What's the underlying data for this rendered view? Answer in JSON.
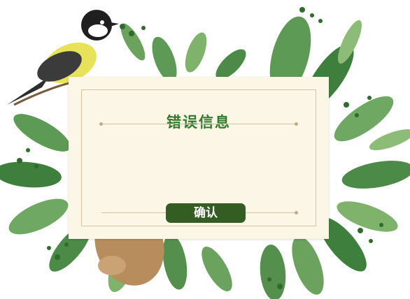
{
  "dialog": {
    "title": "错误信息",
    "confirm_label": "确认"
  },
  "colors": {
    "title": "#2f7a2c",
    "button_bg": "#345d24",
    "card_bg": "#fbf6e5",
    "frame": "#d6c3a1"
  }
}
